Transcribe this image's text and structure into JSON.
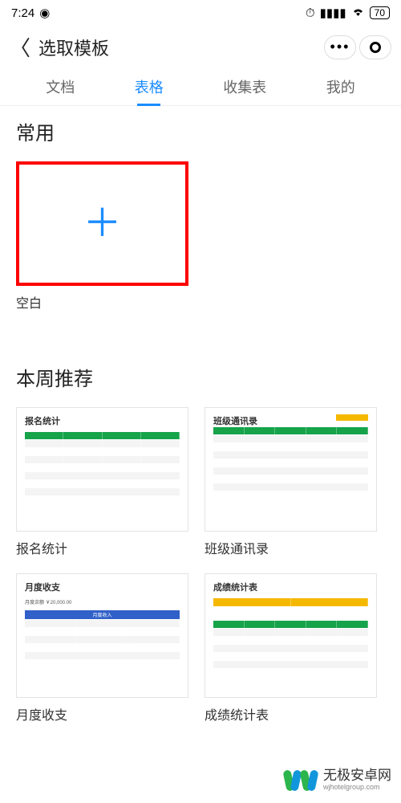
{
  "status": {
    "time": "7:24",
    "battery": "70"
  },
  "header": {
    "title": "选取模板"
  },
  "tabs": [
    {
      "label": "文档",
      "active": false
    },
    {
      "label": "表格",
      "active": true
    },
    {
      "label": "收集表",
      "active": false
    },
    {
      "label": "我的",
      "active": false
    }
  ],
  "sections": {
    "frequent": {
      "title": "常用"
    },
    "weekly": {
      "title": "本周推荐"
    }
  },
  "templates": {
    "blank": {
      "label": "空白"
    },
    "weekly": [
      {
        "label": "报名统计",
        "thumb_title": "报名统计",
        "header_color": "green"
      },
      {
        "label": "班级通讯录",
        "thumb_title": "班级通讯录",
        "header_color": "green",
        "accent": "yellow"
      },
      {
        "label": "月度收支",
        "thumb_title": "月度收支",
        "subhead": "月度收入",
        "header_color": "blue"
      },
      {
        "label": "成绩统计表",
        "thumb_title": "成绩统计表",
        "header_color": "green",
        "accent": "yellow"
      }
    ]
  },
  "watermark": {
    "main": "无极安卓网",
    "sub": "wjhotelgroup.com"
  }
}
